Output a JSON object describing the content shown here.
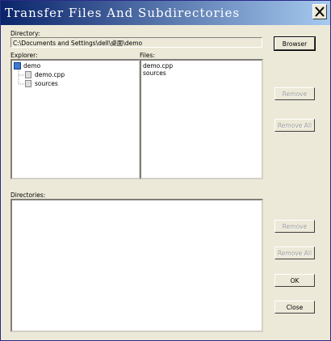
{
  "window": {
    "title": "Transfer Files And Subdirectories"
  },
  "directory": {
    "label": "Directory:",
    "path": "C:\\Documents and Settings\\dell\\桌面\\demo"
  },
  "explorer": {
    "label": "Explorer:",
    "root": "demo",
    "children": [
      "demo.cpp",
      "sources"
    ]
  },
  "files": {
    "label": "Files:",
    "items": [
      "demo.cpp",
      "sources"
    ]
  },
  "directories": {
    "label": "Directories:"
  },
  "buttons": {
    "browser": "Browser",
    "remove_files": "Remove",
    "remove_all_files": "Remove All",
    "remove_dirs": "Remove",
    "remove_all_dirs": "Remove All",
    "ok": "OK",
    "close": "Close"
  }
}
